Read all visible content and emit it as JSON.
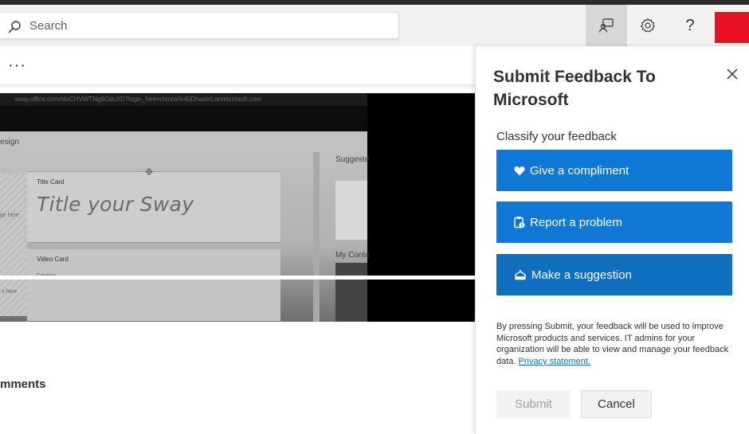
{
  "topbar": {
    "search": {
      "placeholder": "Search"
    },
    "feedback_button": {
      "icon": "feedback-icon",
      "active": true
    },
    "settings_button": {
      "icon": "gear-icon"
    },
    "help_button": {
      "icon": "help-icon",
      "glyph": "?"
    },
    "accent_color": "#e81123"
  },
  "subbar": {
    "more_label": "···"
  },
  "preview": {
    "url": "sway.office.com/idoCHVWTNg8OdcXD?login_hint=chinns%40Dhaatril.onmicrosoft.com",
    "design_label": "esign",
    "card1_label": "Title Card",
    "card1_title": "Title your Sway",
    "card2_label": "Video Card",
    "card2_caption": "Caption",
    "left_text1": "ge here",
    "left_text2": "s here",
    "suggested": "Suggeste",
    "my_content": "My Conte"
  },
  "main": {
    "comments_label": "mments"
  },
  "feedback_panel": {
    "title": "Submit Feedback To Microsoft",
    "classify_label": "Classify your feedback",
    "options": [
      {
        "label": "Give a compliment",
        "icon": "heart-icon"
      },
      {
        "label": "Report a problem",
        "icon": "clipboard-alert-icon"
      },
      {
        "label": "Make a suggestion",
        "icon": "lightbulb-icon",
        "selected": true
      }
    ],
    "disclaimer": "By pressing Submit, your feedback will be used to improve Microsoft products and services. IT admins for your organization will be able to view and manage your feedback data.",
    "privacy_link": "Privacy statement.",
    "submit_label": "Submit",
    "cancel_label": "Cancel",
    "button_color": "#0f78d4"
  }
}
